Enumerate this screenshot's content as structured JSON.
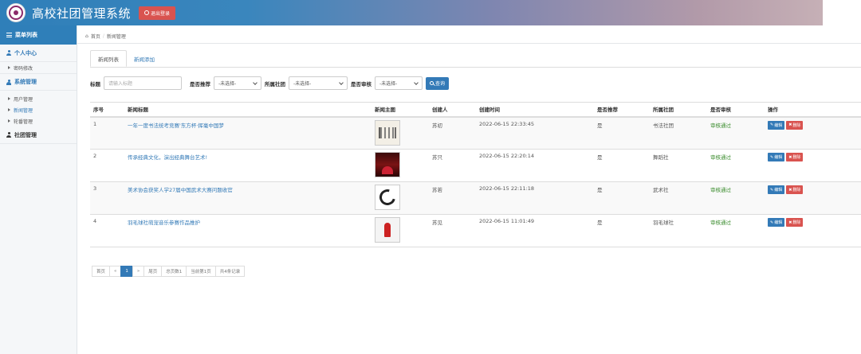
{
  "header": {
    "title": "高校社团管理系统",
    "logout_label": "退出登录"
  },
  "sidebar": {
    "head_label": "菜单列表",
    "groups": [
      {
        "label": "个人中心",
        "items": [
          "密码修改"
        ]
      },
      {
        "label": "系统管理",
        "items": [
          "用户管理",
          "新闻管理",
          "轮番管理"
        ]
      },
      {
        "label": "社团管理",
        "items": []
      }
    ]
  },
  "breadcrumb": {
    "home": "首页",
    "current": "新闻管理"
  },
  "tabs": [
    "新闻列表",
    "新闻添加"
  ],
  "filter": {
    "title_label": "标题",
    "title_placeholder": "请输入标题",
    "recommend_label": "是否推荐",
    "recommend_value": "-未选择-",
    "club_label": "所属社团",
    "club_value": "-未选择-",
    "audit_label": "是否审核",
    "audit_value": "-未选择-",
    "search_label": "查询"
  },
  "table": {
    "columns": [
      "序号",
      "新闻标题",
      "新闻主图",
      "创建人",
      "创建时间",
      "是否推荐",
      "所属社团",
      "是否审核",
      "操作"
    ],
    "rows": [
      {
        "no": "1",
        "title": "一年一度书法统考竞赛'东方杯·挥毫中国梦",
        "creator": "苏初",
        "time": "2022-06-15 22:33:45",
        "recommend": "是",
        "club": "书法社团",
        "status": "审核通过"
      },
      {
        "no": "2",
        "title": "传承经典文化，演出经典舞台艺术!",
        "creator": "苏只",
        "time": "2022-06-15 22:20:14",
        "recommend": "是",
        "club": "舞蹈社",
        "status": "审核通过"
      },
      {
        "no": "3",
        "title": "美术协会获奖人学27届中国武术大赛问题收官",
        "creator": "苏若",
        "time": "2022-06-15 22:11:18",
        "recommend": "是",
        "club": "武术社",
        "status": "审核通过"
      },
      {
        "no": "4",
        "title": "羽毛球社萌宠音乐参赛作品推护",
        "creator": "苏见",
        "time": "2022-06-15 11:01:49",
        "recommend": "是",
        "club": "羽毛球社",
        "status": "审核通过"
      }
    ],
    "edit_label": "编辑",
    "delete_label": "删除"
  },
  "pagination": {
    "first": "首页",
    "prev": "«",
    "current": "1",
    "next": "»",
    "last": "尾页",
    "total_pages": "总页数1",
    "current_page": "当前第1页",
    "total_records": "共4条记录"
  }
}
